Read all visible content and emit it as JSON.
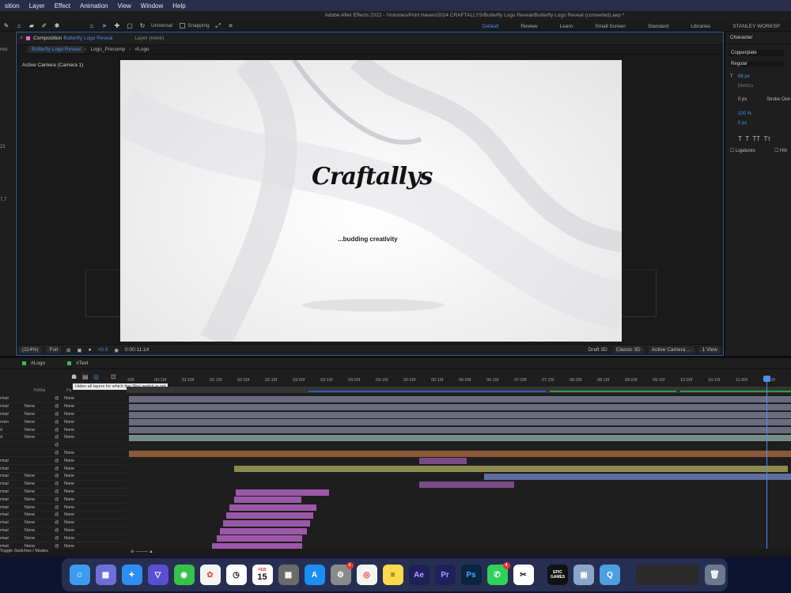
{
  "menubar": {
    "items": [
      "sition",
      "Layer",
      "Effect",
      "Animation",
      "View",
      "Window",
      "Help"
    ]
  },
  "window_title": "Adobe After Effects 2022 - /Volumes/Print Haven/2024 CRAFTALLYS/Butterfly Logo Reveal/Butterfly Logo Reveal (converted).aep *",
  "toolbar": {
    "universal": "Universal",
    "snapping": "Snapping",
    "workspaces": [
      "Default",
      "Review",
      "Learn",
      "Small Screen",
      "Standard",
      "Libraries",
      "STANLEY WORKSP"
    ]
  },
  "left_panel": {
    "frag1": "nes",
    "frag2": "21",
    "frag3": "7.7"
  },
  "comp_panel": {
    "label": "Composition",
    "comp_name": "Butterfly Logo Reveal",
    "layer_label": "Layer (none)",
    "breadcrumbs": [
      "Butterfly Logo Reveal",
      "Logo_Precomp",
      "#Logo"
    ],
    "active_camera": "Active Camera (Camera 1)",
    "logo_text": "Craftallys",
    "tagline": "...budding creativity",
    "footer": {
      "zoom": "(114%)",
      "resolution": "Full",
      "exposure": "+0.0",
      "timecode": "0:00:11:14",
      "draft": "Draft 3D",
      "renderer": "Classic 3D",
      "camera": "Active Camera ...",
      "views": "1 View"
    }
  },
  "char_panel": {
    "title": "Character",
    "font": "Copperplate",
    "style": "Regular",
    "size": "66 px",
    "metrics": "Metrics",
    "kerning": "0 px",
    "stroke": "Stroke Ove",
    "vscale": "100 %",
    "baseline": "0 px",
    "ligatures": "Ligatures",
    "hindi": "Hin"
  },
  "timeline": {
    "tabs": [
      "#Logo",
      "#Text"
    ],
    "tooltip": "Hides all layers for which the 'Shy' switch is set",
    "col_trkmat": "TrkMat",
    "col_parent": "Pa",
    "ruler_ticks": [
      ":00f",
      "00:15f",
      "01:00f",
      "01:15f",
      "02:00f",
      "02:15f",
      "03:00f",
      "03:15f",
      "04:00f",
      "04:15f",
      "05:00f",
      "05:15f",
      "06:00f",
      "06:15f",
      "07:00f",
      "07:15f",
      "08:00f",
      "08:15f",
      "09:00f",
      "09:15f",
      "10:00f",
      "10:15f",
      "11:00f",
      "11:15f"
    ],
    "rows": [
      {
        "mode": "rmal",
        "trk": "",
        "par": "None"
      },
      {
        "mode": "rmal",
        "trk": "None",
        "par": "None"
      },
      {
        "mode": "rmal",
        "trk": "None",
        "par": "None"
      },
      {
        "mode": "reen",
        "trk": "None",
        "par": "None"
      },
      {
        "mode": "d",
        "trk": "None",
        "par": "None"
      },
      {
        "mode": "d",
        "trk": "None",
        "par": "None"
      },
      {
        "mode": "",
        "trk": "",
        "par": ""
      },
      {
        "mode": "",
        "trk": "",
        "par": "None"
      },
      {
        "mode": "rmal",
        "trk": "",
        "par": "None"
      },
      {
        "mode": "rmal",
        "trk": "",
        "par": "None"
      },
      {
        "mode": "rmal",
        "trk": "None",
        "par": "None"
      },
      {
        "mode": "rmal",
        "trk": "None",
        "par": "None"
      },
      {
        "mode": "rmal",
        "trk": "None",
        "par": "None"
      },
      {
        "mode": "rmal",
        "trk": "None",
        "par": "None"
      },
      {
        "mode": "rmal",
        "trk": "None",
        "par": "None"
      },
      {
        "mode": "rmal",
        "trk": "None",
        "par": "None"
      },
      {
        "mode": "rmal",
        "trk": "None",
        "par": "None"
      },
      {
        "mode": "rmal",
        "trk": "None",
        "par": "None"
      },
      {
        "mode": "rmal",
        "trk": "None",
        "par": "None"
      },
      {
        "mode": "rmal",
        "trk": "None",
        "par": "None"
      }
    ],
    "footer": "Toggle Switches / Modes"
  },
  "dock": {
    "apps": [
      "finder",
      "launchpad",
      "safari",
      "vectorize",
      "messages",
      "photos",
      "clock",
      "calendar",
      "calculator",
      "app-store",
      "system-settings",
      "chrome",
      "notes",
      "after-effects",
      "premiere",
      "photoshop",
      "whatsapp",
      "capcut",
      "epic-games",
      "preview",
      "quicktime",
      "screenshots",
      "trash"
    ],
    "calendar_month": "FEB",
    "calendar_day": "15",
    "badge_settings": "1",
    "badge_whatsapp": "4",
    "ae": "Ae",
    "pr": "Pr",
    "ps": "Ps",
    "epic": "EPIC GAMES"
  },
  "colors": {
    "accent": "#4c8ff0",
    "comp_label": "#e86bd3",
    "tab_label": "#3dbb55"
  }
}
